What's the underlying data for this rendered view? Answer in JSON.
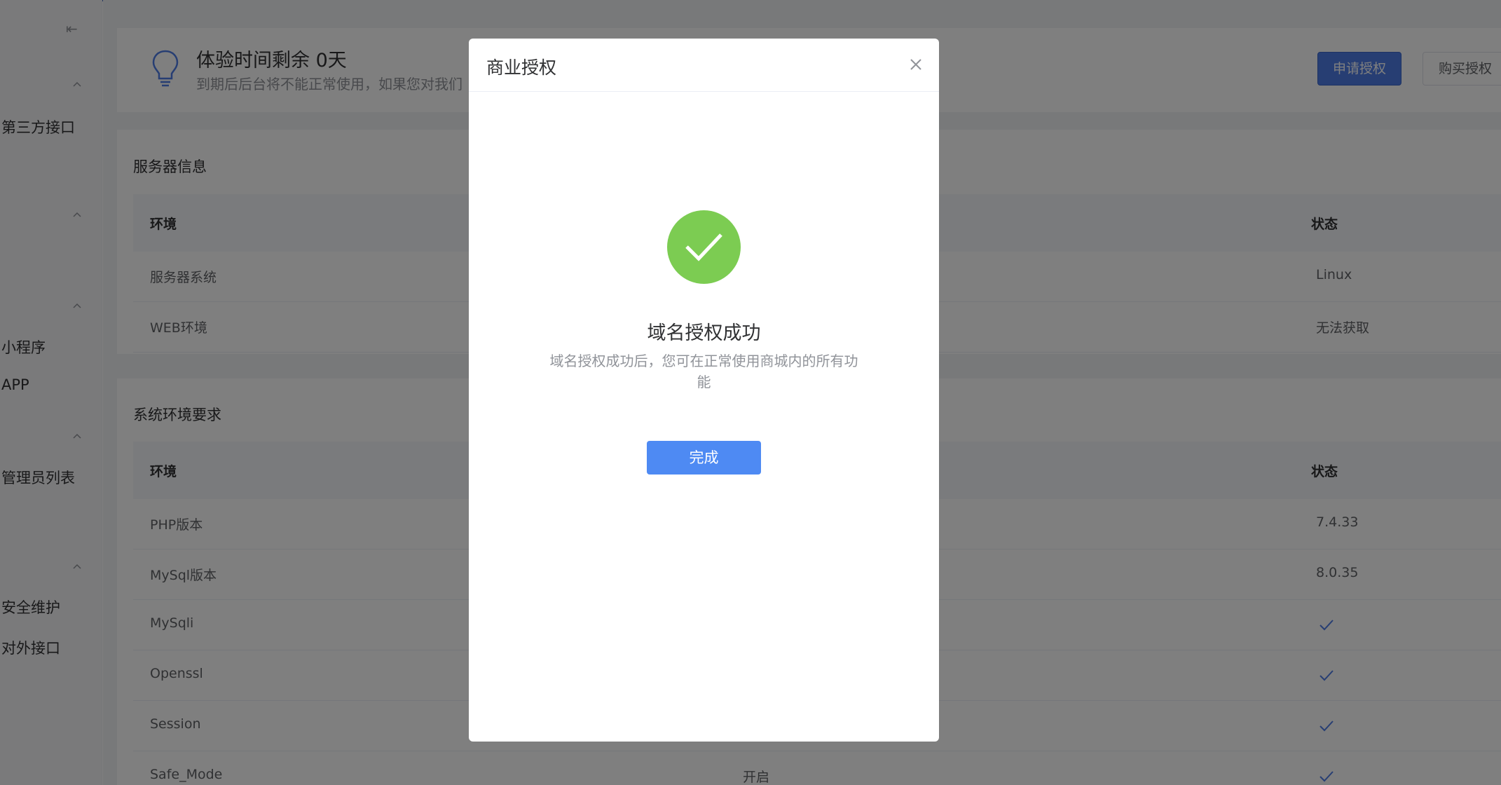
{
  "sidebar": {
    "collapse_glyph": "⇤",
    "items": [
      "第三方接口",
      "小程序",
      "APP",
      "管理员列表",
      "安全维护",
      "对外接口"
    ]
  },
  "trial": {
    "title": "体验时间剩余 0天",
    "subtitle": "到期后后台将不能正常使用，如果您对我们",
    "apply_button": "申请授权",
    "buy_button": "购买授权"
  },
  "server_info": {
    "title": "服务器信息",
    "columns": [
      "环境",
      "状态"
    ],
    "rows": [
      {
        "name": "服务器系统",
        "status": "Linux"
      },
      {
        "name": "WEB环境",
        "status": "无法获取"
      }
    ]
  },
  "sys_req": {
    "title": "系统环境要求",
    "columns": [
      "环境",
      "状态"
    ],
    "rows": [
      {
        "name": "PHP版本",
        "mid": "",
        "status": "7.4.33"
      },
      {
        "name": "MySql版本",
        "mid": "",
        "status": "8.0.35"
      },
      {
        "name": "MySqli",
        "mid": "",
        "status": "",
        "check": true
      },
      {
        "name": "Openssl",
        "mid": "",
        "status": "",
        "check": true
      },
      {
        "name": "Session",
        "mid": "",
        "status": "",
        "check": true
      },
      {
        "name": "Safe_Mode",
        "mid": "开启",
        "status": "",
        "check": true
      }
    ]
  },
  "modal": {
    "title": "商业授权",
    "success_title": "域名授权成功",
    "success_desc": "域名授权成功后，您可在正常使用商城内的所有功能",
    "done_button": "完成"
  },
  "colors": {
    "primary": "#4e8af3",
    "success": "#7ccc52",
    "overlay": "rgba(0,0,0,0.5)"
  }
}
